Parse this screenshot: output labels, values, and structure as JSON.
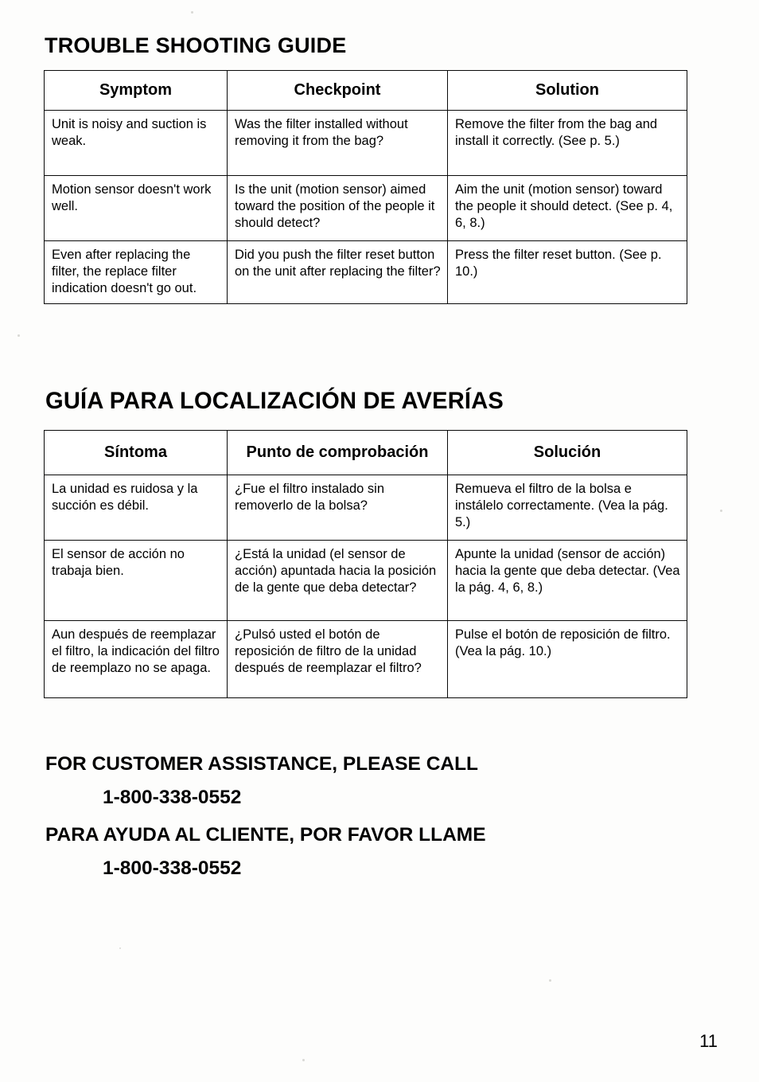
{
  "document": {
    "page_number": "11"
  },
  "english_section": {
    "title": "TROUBLE SHOOTING GUIDE",
    "headers": [
      "Symptom",
      "Checkpoint",
      "Solution"
    ],
    "rows": [
      {
        "symptom": "Unit is noisy and suction is weak.",
        "checkpoint": "Was the filter installed without removing it from the bag?",
        "solution": "Remove the filter from the bag and install it correctly.  (See p. 5.)"
      },
      {
        "symptom": "Motion sensor doesn't work well.",
        "checkpoint": "Is the unit (motion sensor) aimed toward the position of the people it should detect?",
        "solution": "Aim the unit (motion sensor) toward the people it should detect.  (See p. 4, 6, 8.)"
      },
      {
        "symptom": "Even after replacing the filter, the replace filter indication doesn't go out.",
        "checkpoint": "Did you push the filter reset button on the unit after replacing the filter?",
        "solution": "Press the filter reset button. (See p. 10.)"
      }
    ]
  },
  "spanish_section": {
    "title": "GUÍA PARA LOCALIZACIÓN DE AVERÍAS",
    "headers": [
      "Síntoma",
      "Punto de comprobación",
      "Solución"
    ],
    "rows": [
      {
        "symptom": "La unidad es ruidosa y la succión es débil.",
        "checkpoint": "¿Fue el filtro instalado sin removerlo de la bolsa?",
        "solution": "Remueva el filtro de la bolsa e instálelo correctamente. (Vea la pág. 5.)"
      },
      {
        "symptom": "El sensor de acción no trabaja bien.",
        "checkpoint": "¿Está la unidad (el sensor de acción) apuntada hacia la posición de la gente que deba detectar?",
        "solution": "Apunte la unidad (sensor de acción) hacia la gente que deba detectar. (Vea la pág. 4, 6, 8.)"
      },
      {
        "symptom": "Aun después de reemplazar el filtro, la indicación del filtro de reemplazo no se apaga.",
        "checkpoint": "¿Pulsó usted el botón de reposición de filtro de la unidad después de reemplazar el filtro?",
        "solution": "Pulse el botón de reposición de filtro. (Vea la pág. 10.)"
      }
    ]
  },
  "customer_assistance": {
    "english_heading": "FOR CUSTOMER ASSISTANCE, PLEASE CALL",
    "english_phone": "1-800-338-0552",
    "spanish_heading": "PARA AYUDA AL CLIENTE, POR FAVOR LLAME",
    "spanish_phone": "1-800-338-0552"
  }
}
